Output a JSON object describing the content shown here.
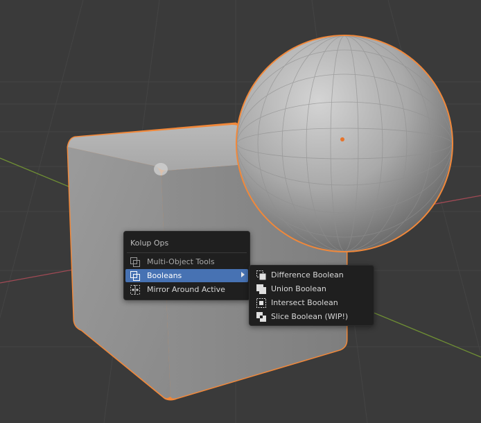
{
  "colors": {
    "background": "#3a3a3a",
    "grid": "#444444",
    "axis_x": "#a24a55",
    "axis_y": "#6f8f34",
    "selection_outline": "#f1883a",
    "menu_background": "#1f1f1f",
    "menu_highlight": "#4772b3"
  },
  "context_menu": {
    "title": "Kolup Ops",
    "items": [
      {
        "label": "Multi-Object Tools",
        "icon": "multi-object-icon",
        "state": "disabled"
      },
      {
        "label": "Booleans",
        "icon": "boolean-icon",
        "state": "active",
        "has_submenu": true
      },
      {
        "label": "Mirror Around Active",
        "icon": "mirror-icon",
        "state": "normal"
      }
    ]
  },
  "boolean_submenu": {
    "items": [
      {
        "label": "Difference Boolean",
        "icon": "difference-boolean-icon"
      },
      {
        "label": "Union Boolean",
        "icon": "union-boolean-icon"
      },
      {
        "label": "Intersect Boolean",
        "icon": "intersect-boolean-icon"
      },
      {
        "label": "Slice Boolean (WIP!)",
        "icon": "slice-boolean-icon"
      }
    ]
  }
}
